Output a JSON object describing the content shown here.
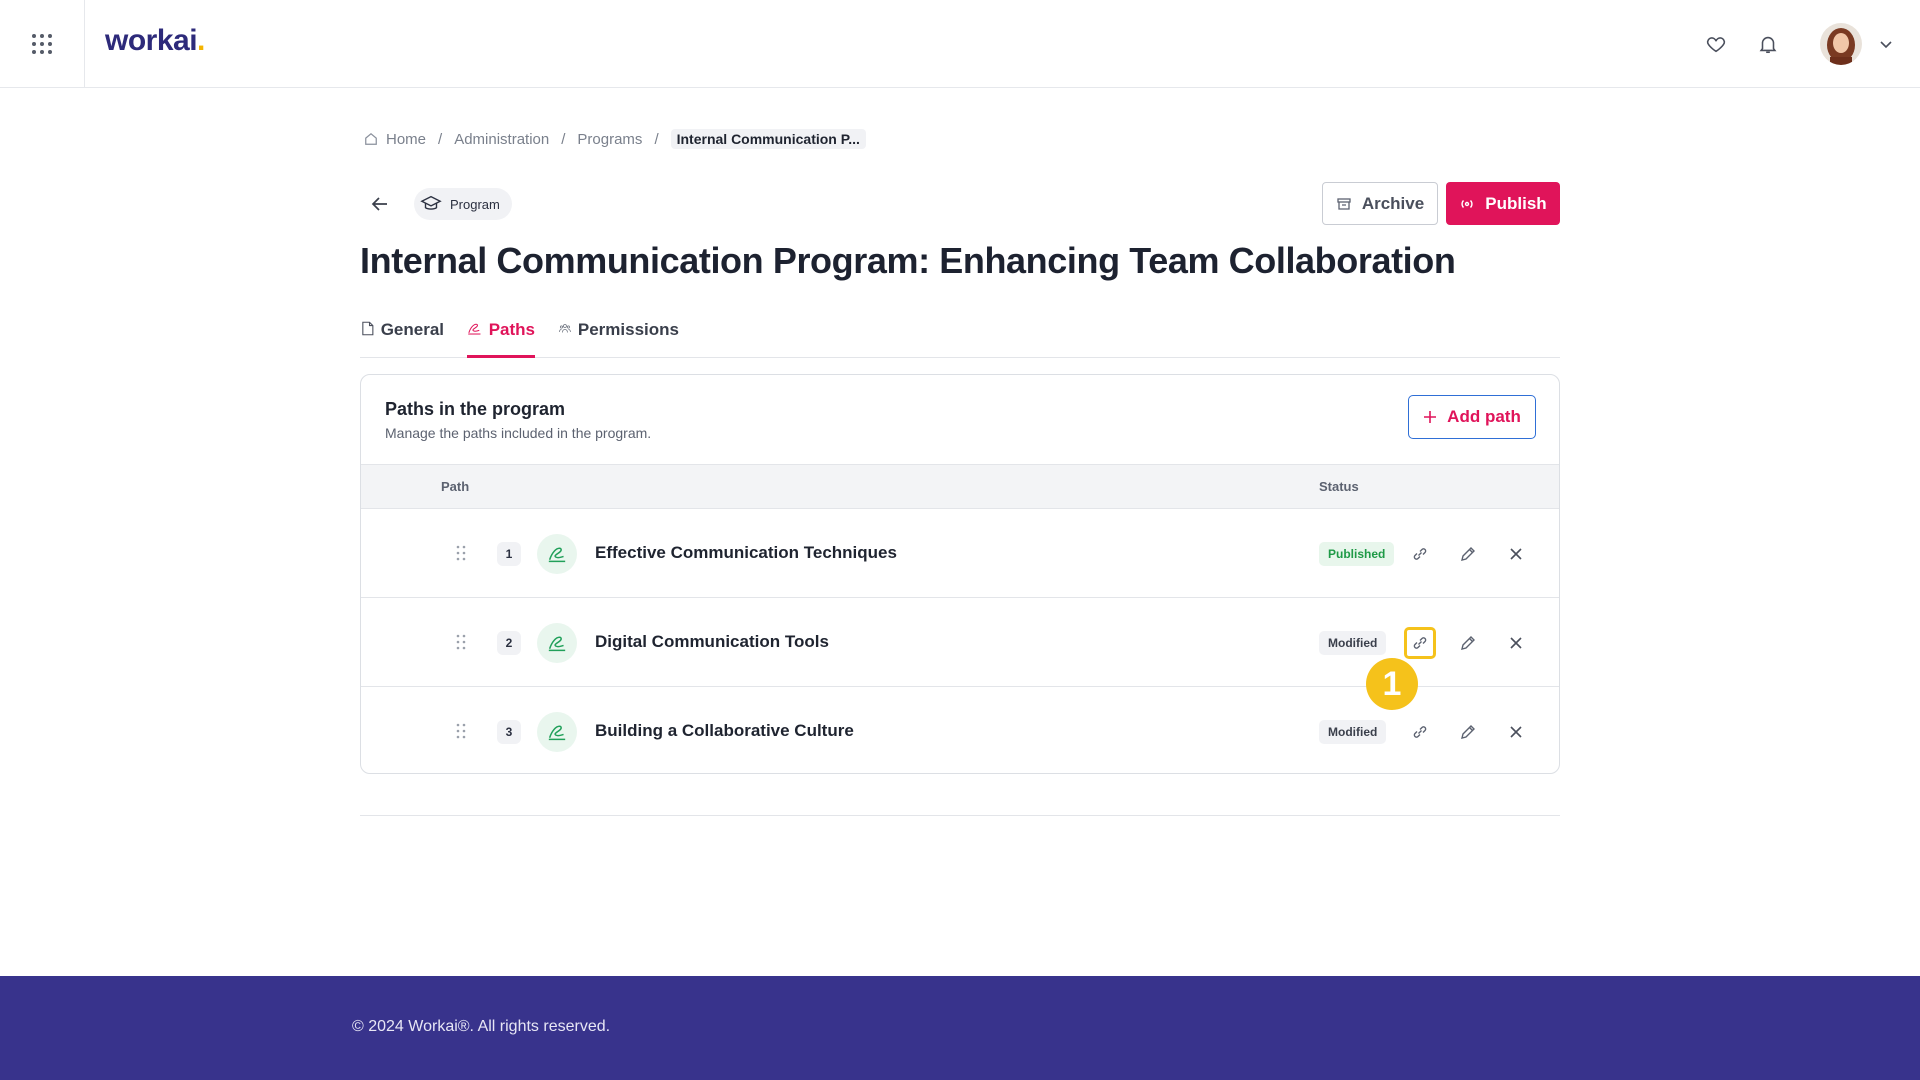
{
  "app": {
    "logo_text": "workai",
    "logo_dot": ".",
    "brand_color": "#2d2a7a",
    "accent_color": "#e0145a"
  },
  "header": {
    "icons": [
      "apps-grid-icon",
      "heart-icon",
      "bell-icon",
      "chevron-down-icon"
    ]
  },
  "breadcrumb": {
    "items": [
      "Home",
      "Administration",
      "Programs"
    ],
    "current": "Internal Communication P...",
    "separator": "/"
  },
  "page": {
    "type_chip": "Program",
    "title": "Internal Communication Program: Enhancing Team Collaboration",
    "archive_label": "Archive",
    "publish_label": "Publish"
  },
  "tabs": [
    {
      "label": "General",
      "icon": "document-icon",
      "active": false
    },
    {
      "label": "Paths",
      "icon": "path-icon",
      "active": true
    },
    {
      "label": "Permissions",
      "icon": "users-icon",
      "active": false
    }
  ],
  "card": {
    "title": "Paths in the program",
    "subtitle": "Manage the paths included in the program.",
    "add_button": "Add path",
    "columns": {
      "path": "Path",
      "status": "Status"
    },
    "rows": [
      {
        "index": "1",
        "name": "Effective Communication Techniques",
        "status": "Published",
        "status_kind": "published"
      },
      {
        "index": "2",
        "name": "Digital Communication Tools",
        "status": "Modified",
        "status_kind": "modified"
      },
      {
        "index": "3",
        "name": "Building a Collaborative Culture",
        "status": "Modified",
        "status_kind": "modified"
      }
    ]
  },
  "annotation": {
    "marker": "1",
    "marker_color": "#f5c21b"
  },
  "footer": {
    "text": "© 2024 Workai®. All rights reserved."
  }
}
